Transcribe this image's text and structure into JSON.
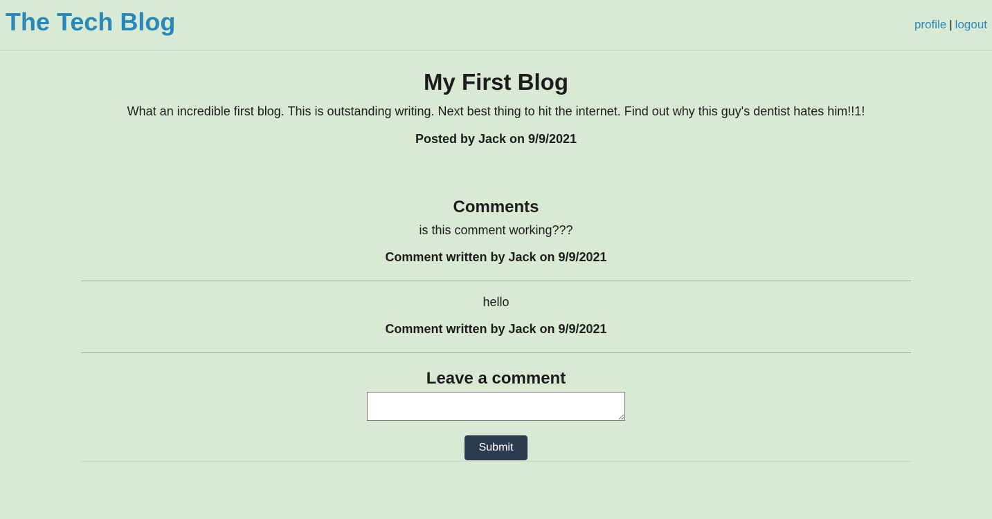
{
  "header": {
    "site_title": "The Tech Blog",
    "nav": {
      "profile_label": "profile",
      "separator": "|",
      "logout_label": "logout"
    }
  },
  "post": {
    "title": "My First Blog",
    "body": "What an incredible first blog. This is outstanding writing. Next best thing to hit the internet. Find out why this guy's dentist hates him!!1!",
    "meta": "Posted by Jack on 9/9/2021"
  },
  "comments": {
    "heading": "Comments",
    "items": [
      {
        "text": "is this comment working???",
        "meta": "Comment written by Jack on 9/9/2021"
      },
      {
        "text": "hello",
        "meta": "Comment written by Jack on 9/9/2021"
      }
    ]
  },
  "comment_form": {
    "heading": "Leave a comment",
    "input_value": "",
    "submit_label": "Submit"
  },
  "colors": {
    "background": "#d8ead3",
    "accent_link": "#2a87b9",
    "button": "#2c3a4e"
  }
}
